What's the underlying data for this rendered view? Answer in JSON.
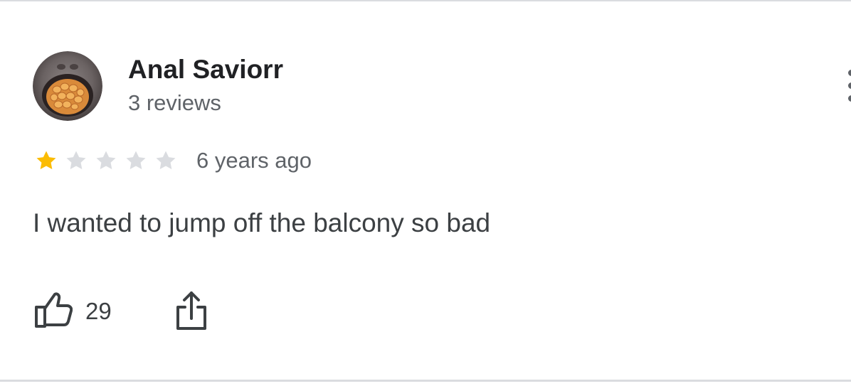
{
  "review": {
    "reviewer_name": "Anal Saviorr",
    "review_count": "3 reviews",
    "rating": 1,
    "max_rating": 5,
    "time_ago": "6 years ago",
    "text": "I wanted to jump off the balcony so bad",
    "like_count": "29"
  },
  "icons": {
    "avatar": "avatar-image",
    "more": "more-vert-icon",
    "star_filled": "star-filled-icon",
    "star_empty": "star-empty-icon",
    "like": "thumbs-up-icon",
    "share": "share-icon"
  },
  "colors": {
    "star_filled": "#fbbc04",
    "star_empty": "#dadce0",
    "name": "#202124",
    "secondary_text": "#5f6368",
    "body_text": "#3c4043",
    "divider": "#dadce0"
  }
}
